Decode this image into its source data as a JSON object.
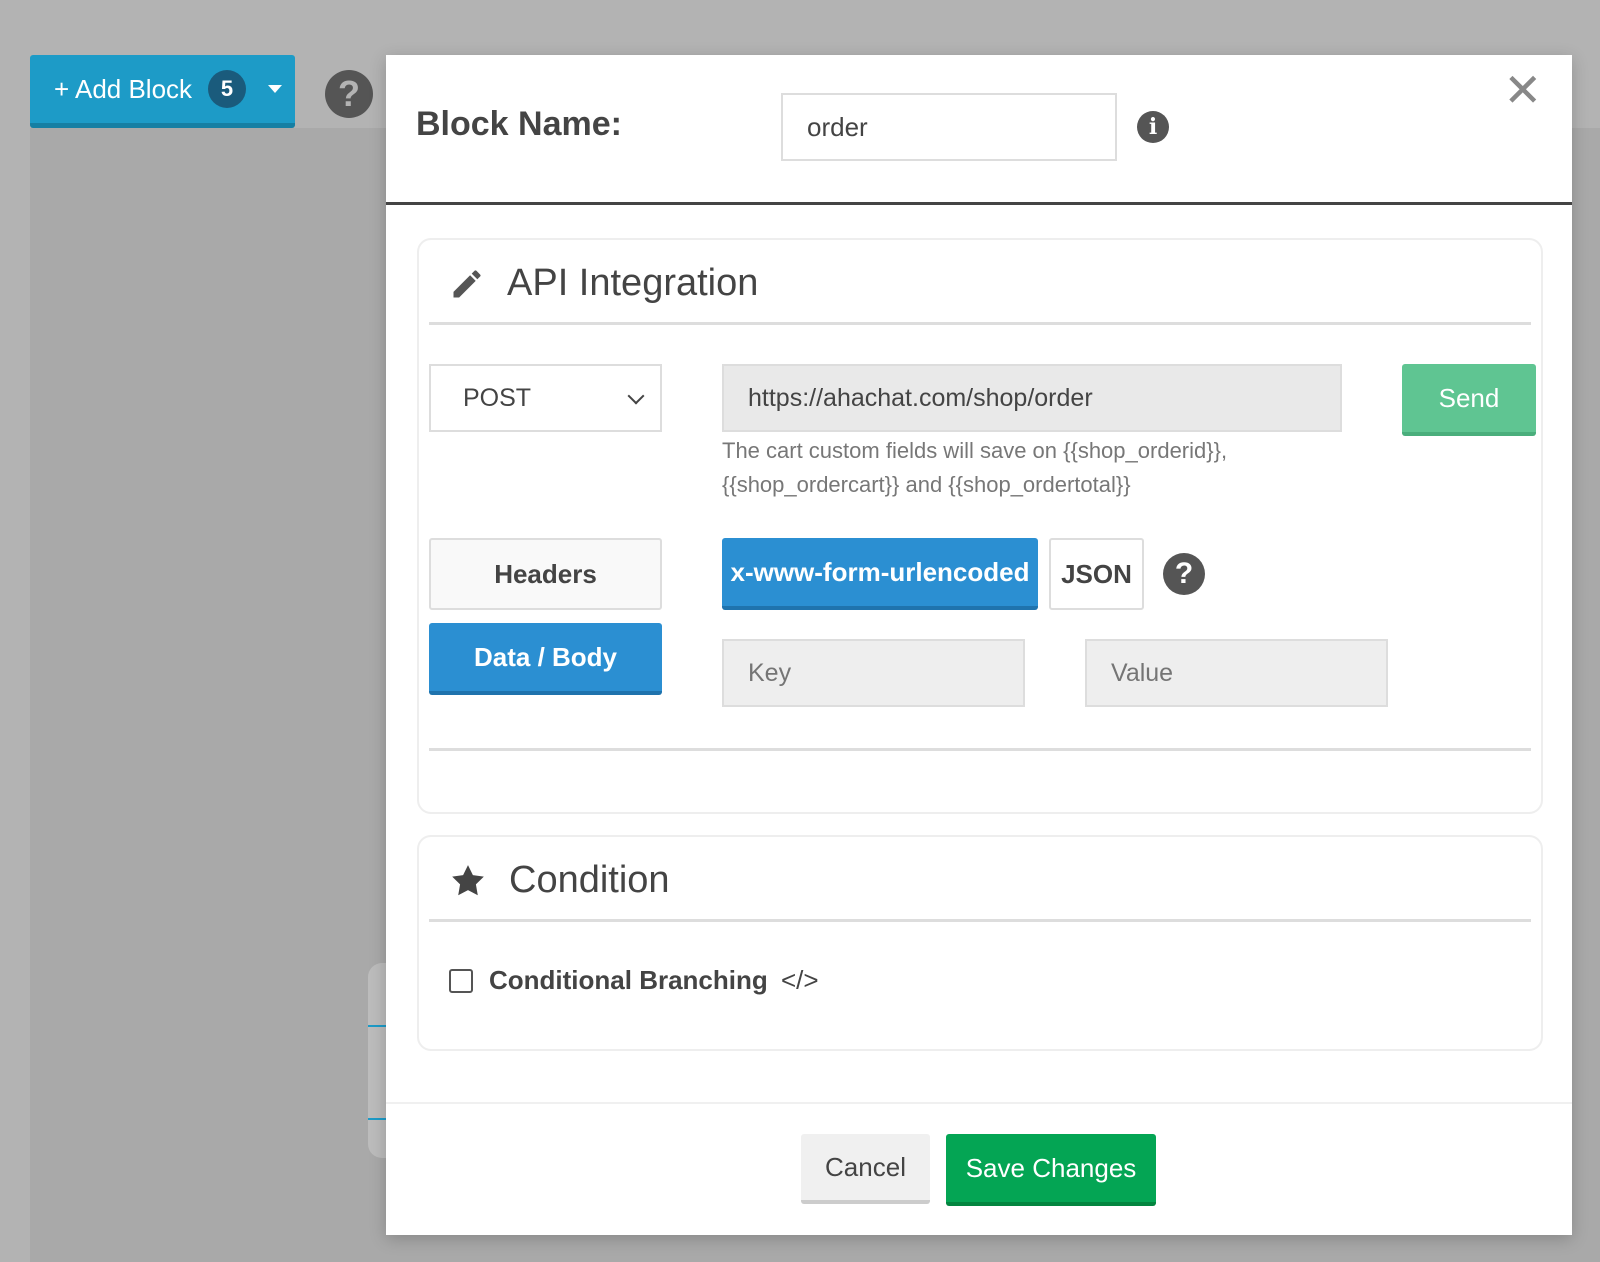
{
  "background": {
    "add_block_label": "+ Add Block",
    "add_block_count": "5",
    "help_glyph": "?"
  },
  "modal": {
    "block_name_label": "Block Name:",
    "block_name_value": "order",
    "info_glyph": "i",
    "close_glyph": "✕"
  },
  "api": {
    "title": "API Integration",
    "method": "POST",
    "url": "https://ahachat.com/shop/order",
    "send_label": "Send",
    "hint": "The cart custom fields will save on {{shop_orderid}}, {{shop_ordercart}} and {{shop_ordertotal}}",
    "headers_label": "Headers",
    "data_body_label": "Data / Body",
    "encoding_urlencoded_label": "x-www-form-urlencoded",
    "encoding_json_label": "JSON",
    "help_glyph": "?",
    "key_placeholder": "Key",
    "value_placeholder": "Value"
  },
  "condition": {
    "title": "Condition",
    "checkbox_label": "Conditional Branching",
    "code_glyph": "</>"
  },
  "footer": {
    "cancel_label": "Cancel",
    "save_label": "Save Changes"
  },
  "colors": {
    "primary_blue": "#2b8fd2",
    "send_green": "#5fc592",
    "save_green": "#04a554",
    "add_block_blue": "#1d9bc7"
  },
  "icons": {
    "api_section": "pencil-icon",
    "condition_section": "star-icon",
    "close": "close-icon",
    "info": "info-icon",
    "help": "question-circle-icon"
  }
}
